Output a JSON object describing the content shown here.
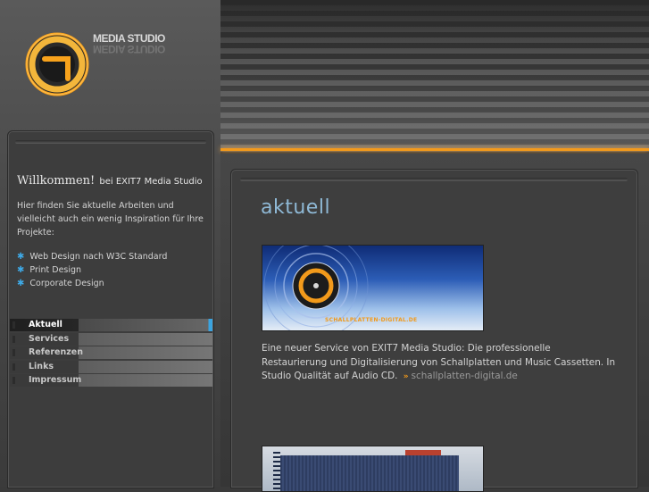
{
  "brand": {
    "name": "MEDIA STUDIO"
  },
  "sidebar": {
    "welcome_big": "Willkommen!",
    "welcome_small": "bei EXIT7 Media Studio",
    "intro": "Hier finden Sie aktuelle Arbeiten und vielleicht auch ein wenig Inspiration für Ihre Projekte:",
    "features": [
      "Web Design nach W3C Standard",
      "Print Design",
      "Corporate Design"
    ],
    "nav": [
      {
        "label": "Aktuell",
        "active": true
      },
      {
        "label": "Services",
        "active": false
      },
      {
        "label": "Referenzen",
        "active": false
      },
      {
        "label": "Links",
        "active": false
      },
      {
        "label": "Impressum",
        "active": false
      }
    ]
  },
  "main": {
    "heading": "aktuell",
    "teaser_label": "SCHALLPLATTEN-DIGITAL.DE",
    "news_text": "Eine neuer Service von EXIT7 Media Studio: Die professionelle Restaurierung und Digitalisierung von Schallplatten und Music Cassetten. In Studio Qualität auf Audio CD.",
    "news_link": "schallplatten-digital.de"
  },
  "colors": {
    "accent_orange": "#f39a1c",
    "accent_blue": "#3ba4e0",
    "heading_blue": "#8fb9d6"
  },
  "icons": {
    "feature_bullet": "star-icon",
    "link_arrow": "double-chevron-right-icon"
  }
}
